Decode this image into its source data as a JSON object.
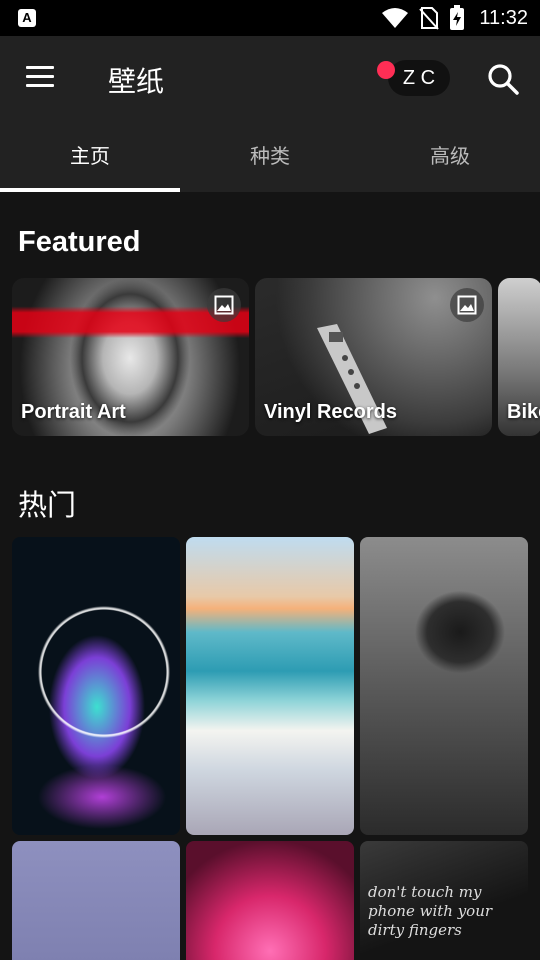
{
  "status_bar": {
    "time": "11:32",
    "icons": [
      "app-notification-icon",
      "wifi-icon",
      "no-sim-icon",
      "battery-charging-icon"
    ]
  },
  "app_bar": {
    "title": "壁纸",
    "pill_text": "Z C",
    "icons": [
      "menu-icon",
      "search-icon"
    ],
    "colors": {
      "bar": "#222222",
      "dot": "#ff2e55"
    }
  },
  "tabs": [
    {
      "label": "主页",
      "active": true
    },
    {
      "label": "种类",
      "active": false
    },
    {
      "label": "高级",
      "active": false
    }
  ],
  "featured": {
    "title": "Featured",
    "cards": [
      {
        "label": "Portrait Art",
        "badge_icon": "image-icon"
      },
      {
        "label": "Vinyl Records",
        "badge_icon": "image-icon"
      },
      {
        "label": "Bike"
      }
    ]
  },
  "hot": {
    "title": "热门",
    "tiles": [
      {
        "subject": "wolf-neon"
      },
      {
        "subject": "beach-waves"
      },
      {
        "subject": "black-rose"
      },
      {
        "subject": "lavender"
      },
      {
        "subject": "pink-sparkle"
      },
      {
        "subject": "text-quote",
        "text": "don't touch my phone with your dirty fingers"
      }
    ]
  }
}
